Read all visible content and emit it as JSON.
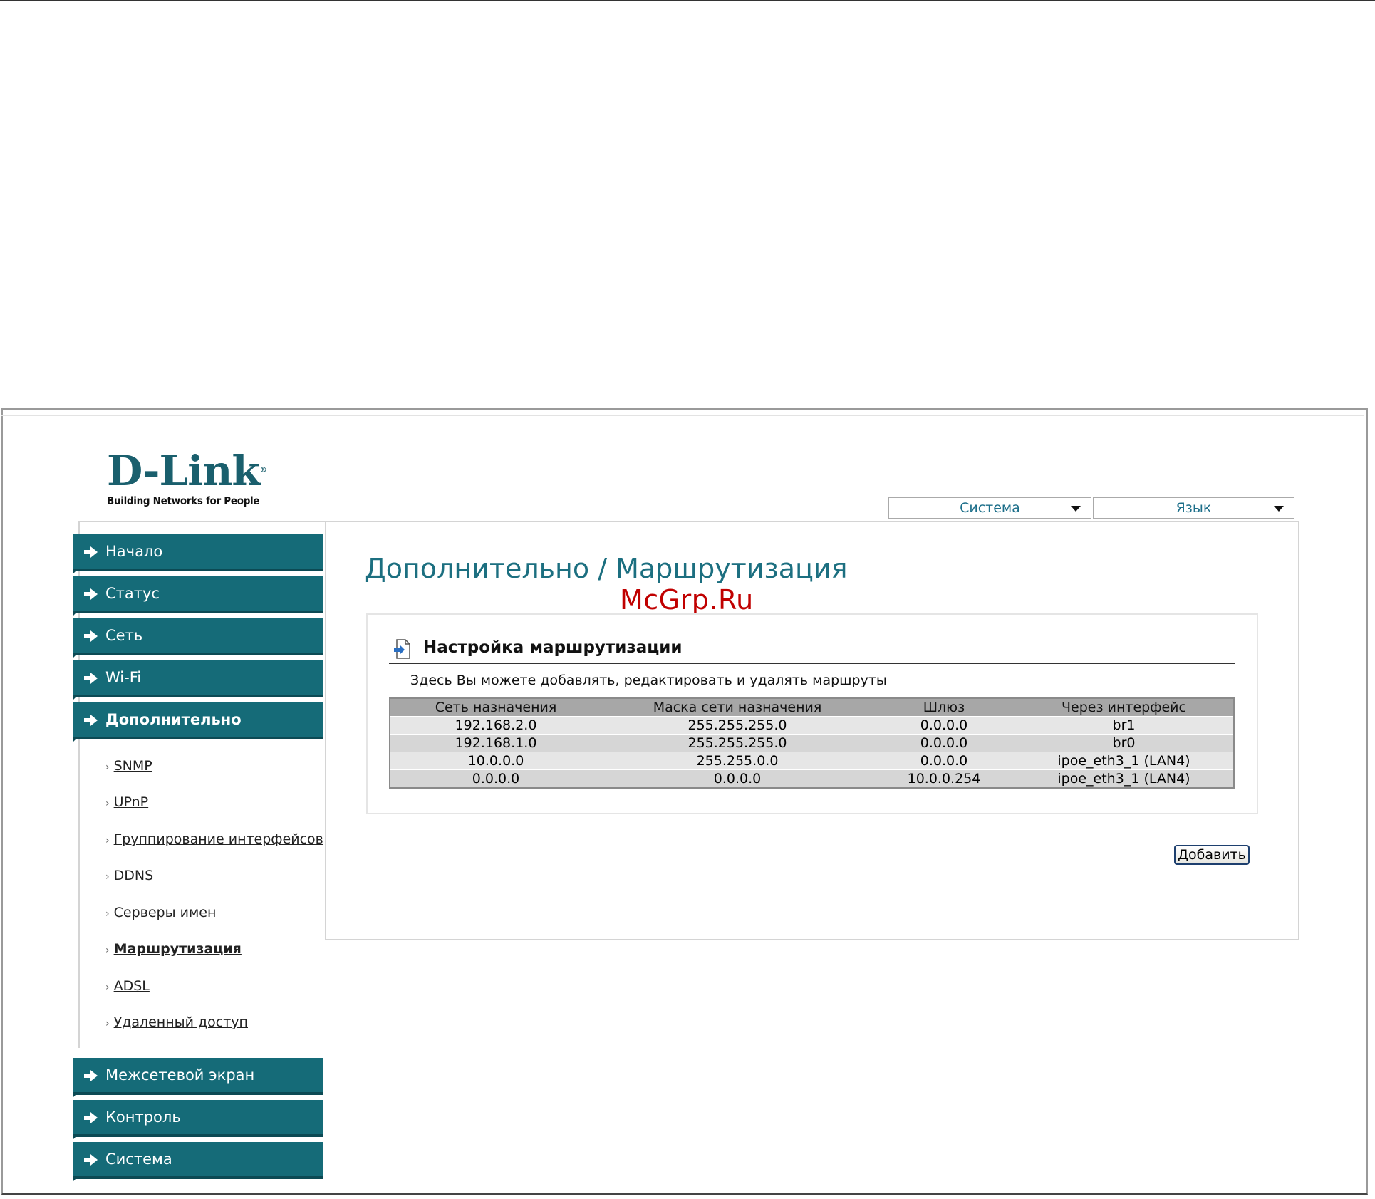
{
  "watermark": "McGrp.Ru",
  "logo": {
    "brand": "D-Link",
    "registered": "®",
    "tagline": "Building Networks for People"
  },
  "header": {
    "system_dropdown": "Система",
    "language_dropdown": "Язык"
  },
  "nav": {
    "items_top": [
      {
        "label": "Начало"
      },
      {
        "label": "Статус"
      },
      {
        "label": "Сеть"
      },
      {
        "label": "Wi-Fi"
      },
      {
        "label": "Дополнительно"
      }
    ],
    "sub_items": [
      {
        "label": "SNMP"
      },
      {
        "label": "UPnP"
      },
      {
        "label": "Группирование интерфейсов"
      },
      {
        "label": "DDNS"
      },
      {
        "label": "Серверы имен"
      },
      {
        "label": "Маршрутизация"
      },
      {
        "label": "ADSL"
      },
      {
        "label": "Удаленный доступ"
      }
    ],
    "items_bottom": [
      {
        "label": "Межсетевой экран"
      },
      {
        "label": "Контроль"
      },
      {
        "label": "Система"
      }
    ],
    "sub_bullet": "›",
    "active_item": "Дополнительно",
    "active_sub_item": "Маршрутизация"
  },
  "page": {
    "title": "Дополнительно /  Маршрутизация"
  },
  "section": {
    "title": "Настройка маршрутизации",
    "description": "Здесь Вы можете добавлять, редактировать и удалять маршруты",
    "icon": "page-arrow-icon"
  },
  "routes_table": {
    "columns": [
      "Сеть назначения",
      "Маска сети назначения",
      "Шлюз",
      "Через интерфейс"
    ],
    "rows": [
      [
        "192.168.2.0",
        "255.255.255.0",
        "0.0.0.0",
        "br1"
      ],
      [
        "192.168.1.0",
        "255.255.255.0",
        "0.0.0.0",
        "br0"
      ],
      [
        "10.0.0.0",
        "255.255.0.0",
        "0.0.0.0",
        "ipoe_eth3_1 (LAN4)"
      ],
      [
        "0.0.0.0",
        "0.0.0.0",
        "10.0.0.254",
        "ipoe_eth3_1 (LAN4)"
      ]
    ]
  },
  "actions": {
    "add_button": "Добавить"
  },
  "colors": {
    "nav_bg": "#156b78",
    "title": "#1c6f80",
    "brand": "#1a5f6d",
    "watermark": "#c00000"
  }
}
